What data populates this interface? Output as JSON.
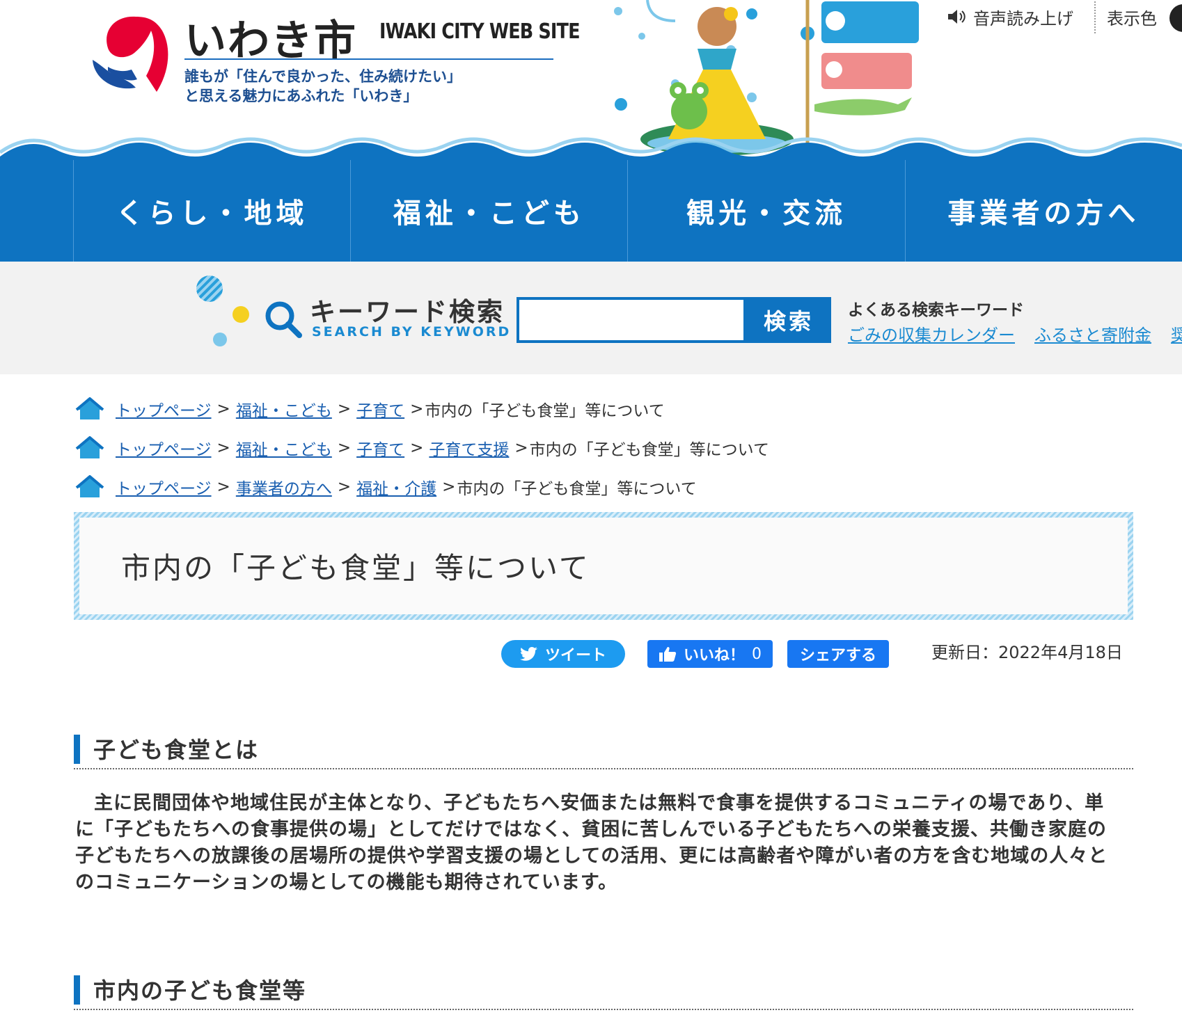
{
  "header": {
    "site_name": "いわき市",
    "site_name_en": "IWAKI CITY WEB SITE",
    "tagline_line1": "誰もが「住んで良かった、住み続けたい」",
    "tagline_line2": "と思える魅力にあふれた「いわき」",
    "voice_label": "音声読み上げ",
    "color_label": "表示色"
  },
  "nav": {
    "items": [
      {
        "label": "くらし・地域"
      },
      {
        "label": "福祉・こども"
      },
      {
        "label": "観光・交流"
      },
      {
        "label": "事業者の方へ"
      }
    ]
  },
  "search": {
    "title": "キーワード検索",
    "subtitle": "SEARCH BY KEYWORD",
    "input_value": "",
    "button_label": "検索",
    "popular_label": "よくある検索キーワード",
    "popular_links": [
      "ごみの収集カレンダー",
      "ふるさと寄附金",
      "奨"
    ]
  },
  "breadcrumbs": [
    {
      "links": [
        "トップページ",
        "福祉・こども",
        "子育て"
      ],
      "current": "市内の「子ども食堂」等について"
    },
    {
      "links": [
        "トップページ",
        "福祉・こども",
        "子育て",
        "子育て支援"
      ],
      "current": "市内の「子ども食堂」等について"
    },
    {
      "links": [
        "トップページ",
        "事業者の方へ",
        "福祉・介護"
      ],
      "current": "市内の「子ども食堂」等について"
    }
  ],
  "page": {
    "title": "市内の「子ども食堂」等について",
    "updated": "更新日：2022年4月18日"
  },
  "social": {
    "tweet_label": "ツイート",
    "like_label": "いいね！",
    "like_count": "0",
    "share_label": "シェアする"
  },
  "sections": [
    {
      "heading": "子ども食堂とは",
      "body": "主に民間団体や地域住民が主体となり、子どもたちへ安価または無料で食事を提供するコミュニティの場であり、単に「子どもたちへの食事提供の場」としてだけではなく、貧困に苦しんでいる子どもたちへの栄養支援、共働き家庭の子どもたちへの放課後の居場所の提供や学習支援の場としての活用、更には高齢者や障がい者の方を含む地域の人々とのコミュニケーションの場としての機能も期待されています。"
    },
    {
      "heading": "市内の子ども食堂等"
    }
  ],
  "colors": {
    "brand_blue": "#0e73c1",
    "link_blue": "#1a5fb0",
    "accent_red": "#e60033",
    "twitter": "#1d9bf0",
    "facebook": "#1877f2"
  }
}
